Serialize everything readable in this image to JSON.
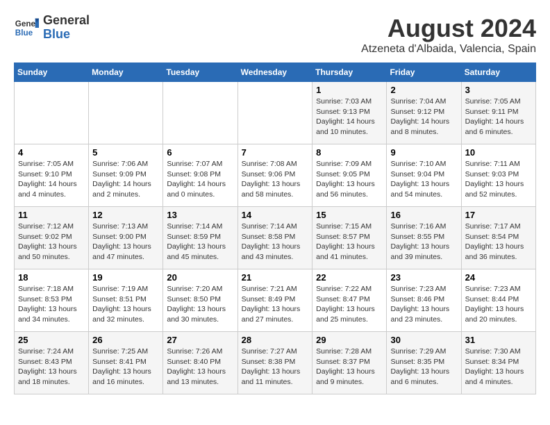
{
  "header": {
    "logo_line1": "General",
    "logo_line2": "Blue",
    "month": "August 2024",
    "location": "Atzeneta d'Albaida, Valencia, Spain"
  },
  "days_of_week": [
    "Sunday",
    "Monday",
    "Tuesday",
    "Wednesday",
    "Thursday",
    "Friday",
    "Saturday"
  ],
  "weeks": [
    [
      {
        "day": "",
        "info": ""
      },
      {
        "day": "",
        "info": ""
      },
      {
        "day": "",
        "info": ""
      },
      {
        "day": "",
        "info": ""
      },
      {
        "day": "1",
        "info": "Sunrise: 7:03 AM\nSunset: 9:13 PM\nDaylight: 14 hours\nand 10 minutes."
      },
      {
        "day": "2",
        "info": "Sunrise: 7:04 AM\nSunset: 9:12 PM\nDaylight: 14 hours\nand 8 minutes."
      },
      {
        "day": "3",
        "info": "Sunrise: 7:05 AM\nSunset: 9:11 PM\nDaylight: 14 hours\nand 6 minutes."
      }
    ],
    [
      {
        "day": "4",
        "info": "Sunrise: 7:05 AM\nSunset: 9:10 PM\nDaylight: 14 hours\nand 4 minutes."
      },
      {
        "day": "5",
        "info": "Sunrise: 7:06 AM\nSunset: 9:09 PM\nDaylight: 14 hours\nand 2 minutes."
      },
      {
        "day": "6",
        "info": "Sunrise: 7:07 AM\nSunset: 9:08 PM\nDaylight: 14 hours\nand 0 minutes."
      },
      {
        "day": "7",
        "info": "Sunrise: 7:08 AM\nSunset: 9:06 PM\nDaylight: 13 hours\nand 58 minutes."
      },
      {
        "day": "8",
        "info": "Sunrise: 7:09 AM\nSunset: 9:05 PM\nDaylight: 13 hours\nand 56 minutes."
      },
      {
        "day": "9",
        "info": "Sunrise: 7:10 AM\nSunset: 9:04 PM\nDaylight: 13 hours\nand 54 minutes."
      },
      {
        "day": "10",
        "info": "Sunrise: 7:11 AM\nSunset: 9:03 PM\nDaylight: 13 hours\nand 52 minutes."
      }
    ],
    [
      {
        "day": "11",
        "info": "Sunrise: 7:12 AM\nSunset: 9:02 PM\nDaylight: 13 hours\nand 50 minutes."
      },
      {
        "day": "12",
        "info": "Sunrise: 7:13 AM\nSunset: 9:00 PM\nDaylight: 13 hours\nand 47 minutes."
      },
      {
        "day": "13",
        "info": "Sunrise: 7:14 AM\nSunset: 8:59 PM\nDaylight: 13 hours\nand 45 minutes."
      },
      {
        "day": "14",
        "info": "Sunrise: 7:14 AM\nSunset: 8:58 PM\nDaylight: 13 hours\nand 43 minutes."
      },
      {
        "day": "15",
        "info": "Sunrise: 7:15 AM\nSunset: 8:57 PM\nDaylight: 13 hours\nand 41 minutes."
      },
      {
        "day": "16",
        "info": "Sunrise: 7:16 AM\nSunset: 8:55 PM\nDaylight: 13 hours\nand 39 minutes."
      },
      {
        "day": "17",
        "info": "Sunrise: 7:17 AM\nSunset: 8:54 PM\nDaylight: 13 hours\nand 36 minutes."
      }
    ],
    [
      {
        "day": "18",
        "info": "Sunrise: 7:18 AM\nSunset: 8:53 PM\nDaylight: 13 hours\nand 34 minutes."
      },
      {
        "day": "19",
        "info": "Sunrise: 7:19 AM\nSunset: 8:51 PM\nDaylight: 13 hours\nand 32 minutes."
      },
      {
        "day": "20",
        "info": "Sunrise: 7:20 AM\nSunset: 8:50 PM\nDaylight: 13 hours\nand 30 minutes."
      },
      {
        "day": "21",
        "info": "Sunrise: 7:21 AM\nSunset: 8:49 PM\nDaylight: 13 hours\nand 27 minutes."
      },
      {
        "day": "22",
        "info": "Sunrise: 7:22 AM\nSunset: 8:47 PM\nDaylight: 13 hours\nand 25 minutes."
      },
      {
        "day": "23",
        "info": "Sunrise: 7:23 AM\nSunset: 8:46 PM\nDaylight: 13 hours\nand 23 minutes."
      },
      {
        "day": "24",
        "info": "Sunrise: 7:23 AM\nSunset: 8:44 PM\nDaylight: 13 hours\nand 20 minutes."
      }
    ],
    [
      {
        "day": "25",
        "info": "Sunrise: 7:24 AM\nSunset: 8:43 PM\nDaylight: 13 hours\nand 18 minutes."
      },
      {
        "day": "26",
        "info": "Sunrise: 7:25 AM\nSunset: 8:41 PM\nDaylight: 13 hours\nand 16 minutes."
      },
      {
        "day": "27",
        "info": "Sunrise: 7:26 AM\nSunset: 8:40 PM\nDaylight: 13 hours\nand 13 minutes."
      },
      {
        "day": "28",
        "info": "Sunrise: 7:27 AM\nSunset: 8:38 PM\nDaylight: 13 hours\nand 11 minutes."
      },
      {
        "day": "29",
        "info": "Sunrise: 7:28 AM\nSunset: 8:37 PM\nDaylight: 13 hours\nand 9 minutes."
      },
      {
        "day": "30",
        "info": "Sunrise: 7:29 AM\nSunset: 8:35 PM\nDaylight: 13 hours\nand 6 minutes."
      },
      {
        "day": "31",
        "info": "Sunrise: 7:30 AM\nSunset: 8:34 PM\nDaylight: 13 hours\nand 4 minutes."
      }
    ]
  ]
}
